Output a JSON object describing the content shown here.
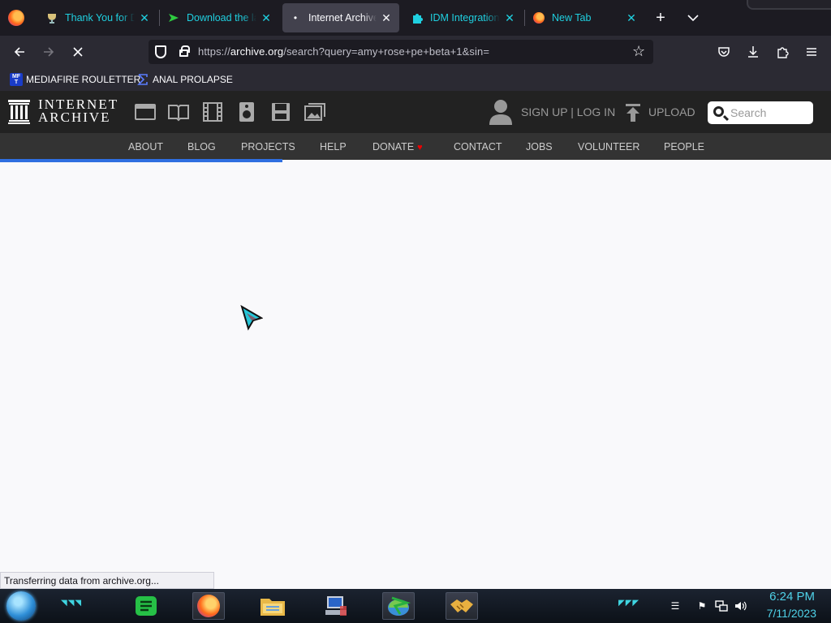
{
  "browser": {
    "tabs": [
      {
        "title": "Thank You for Du",
        "icon": "trophy-icon",
        "active": false
      },
      {
        "title": "Download the lat",
        "icon": "idm-arrow-icon",
        "active": false
      },
      {
        "title": "Internet Archive:",
        "icon": "loading-dot-icon",
        "active": true
      },
      {
        "title": "IDM Integration f",
        "icon": "puzzle-icon",
        "active": false
      },
      {
        "title": "New Tab",
        "icon": "firefox-icon",
        "active": false
      }
    ],
    "url": {
      "prefix": "https://",
      "host": "archive.org",
      "path": "/search?query=amy+rose+pe+beta+1&sin="
    },
    "bookmarks": [
      {
        "label": "MEDIAFIRE ROULETTER",
        "icon": "mf-badge-icon"
      },
      {
        "label": "ANAL PROLAPSE",
        "icon": "sigma-icon"
      }
    ],
    "page_load_progress": 0.34,
    "status_text": "Transferring data from archive.org..."
  },
  "archive": {
    "logo_line1": "INTERNET",
    "logo_line2": "ARCHIVE",
    "media_icons": [
      "web-icon",
      "texts-icon",
      "video-icon",
      "audio-icon",
      "software-icon",
      "images-icon"
    ],
    "signup_label": "SIGN UP | LOG IN",
    "upload_label": "UPLOAD",
    "search_placeholder": "Search",
    "nav": [
      "ABOUT",
      "BLOG",
      "PROJECTS",
      "HELP",
      "DONATE",
      "CONTACT",
      "JOBS",
      "VOLUNTEER",
      "PEOPLE"
    ]
  },
  "taskbar": {
    "apps": [
      "notes-icon",
      "firefox-icon",
      "file-explorer-icon",
      "computer-icon",
      "idm-icon",
      "handshake-icon"
    ],
    "time": "6:24 PM",
    "date": "7/11/2023"
  },
  "colors": {
    "tab_text": "#1fd0e0",
    "ia_header": "#222222",
    "ia_nav": "#333333",
    "progress": "#2f6fe0",
    "clock": "#4fd2e8"
  }
}
